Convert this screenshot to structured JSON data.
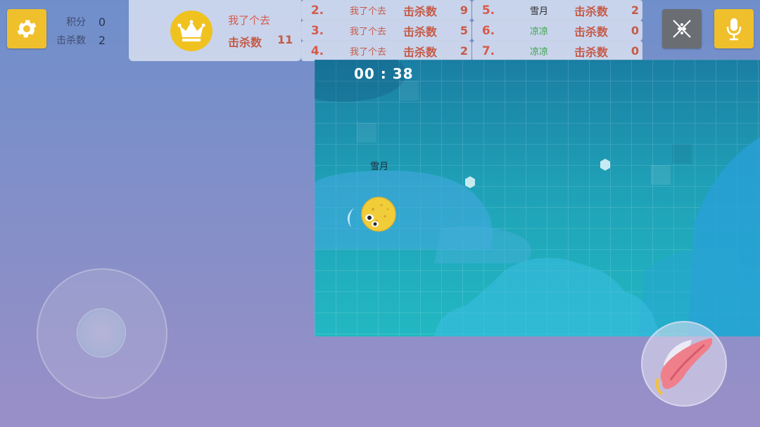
{
  "stats": {
    "score_label": "积分",
    "score_value": "0",
    "kills_label": "击杀数",
    "kills_value": "2"
  },
  "leaderboard": {
    "top": {
      "name": "我了个去",
      "kills_label": "击杀数",
      "kills_value": "11"
    },
    "rows": [
      {
        "rank": "2.",
        "name": "我了个去",
        "kills_label": "击杀数",
        "kills": "9",
        "name_color": "#c65a47"
      },
      {
        "rank": "3.",
        "name": "我了个去",
        "kills_label": "击杀数",
        "kills": "5",
        "name_color": "#c65a47"
      },
      {
        "rank": "4.",
        "name": "我了个去",
        "kills_label": "击杀数",
        "kills": "2",
        "name_color": "#c65a47"
      },
      {
        "rank": "5.",
        "name": "雪月",
        "kills_label": "击杀数",
        "kills": "2",
        "name_color": "#2b2b2b"
      },
      {
        "rank": "6.",
        "name": "凉凉",
        "kills_label": "击杀数",
        "kills": "0",
        "name_color": "#3aa54a"
      },
      {
        "rank": "7.",
        "name": "凉凉",
        "kills_label": "击杀数",
        "kills": "0",
        "name_color": "#3aa54a"
      }
    ]
  },
  "timer": "00 : 38",
  "player": {
    "name": "雪月"
  },
  "icons": {
    "settings": "gear-icon",
    "sound": "sound-muted-icon",
    "mic": "microphone-icon",
    "crown": "crown-icon",
    "attack": "tongue-attack-icon"
  },
  "colors": {
    "accent": "#efc02c",
    "kill_text": "#c65a47"
  }
}
